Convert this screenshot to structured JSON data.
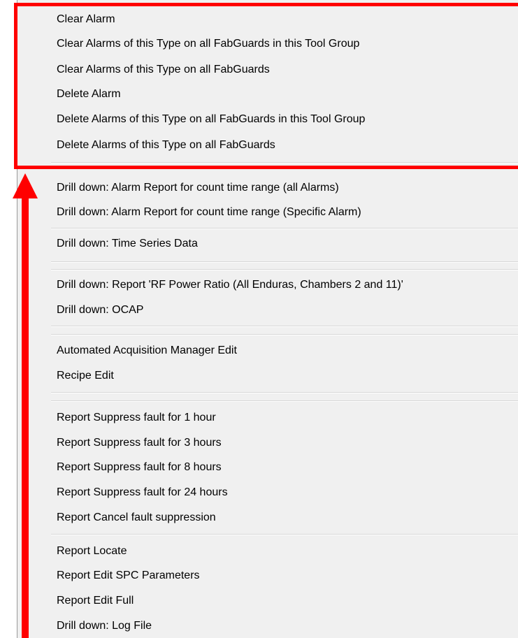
{
  "menu": {
    "items": [
      "Clear Alarm",
      "Clear Alarms of this Type on all FabGuards in this Tool Group",
      "Clear Alarms of this Type on all FabGuards",
      "Delete Alarm",
      "Delete Alarms of this Type on all FabGuards in this Tool Group",
      "Delete Alarms of this Type on all FabGuards",
      "Drill down: Alarm Report for count time range (all Alarms)",
      "Drill down: Alarm Report for count time range (Specific Alarm)",
      "Drill down: Time Series Data",
      "Drill down: Report 'RF Power Ratio (All Enduras, Chambers 2 and 11)'",
      "Drill down: OCAP",
      "Automated Acquisition Manager Edit",
      "Recipe Edit",
      "Report Suppress fault for 1 hour",
      "Report Suppress fault for 3 hours",
      "Report Suppress fault for 8 hours",
      "Report Suppress fault for 24 hours",
      "Report Cancel fault suppression",
      "Report Locate",
      "Report Edit SPC Parameters",
      "Report Edit Full",
      "Drill down: Log File"
    ]
  },
  "annotation": {
    "color": "#ff0000"
  }
}
